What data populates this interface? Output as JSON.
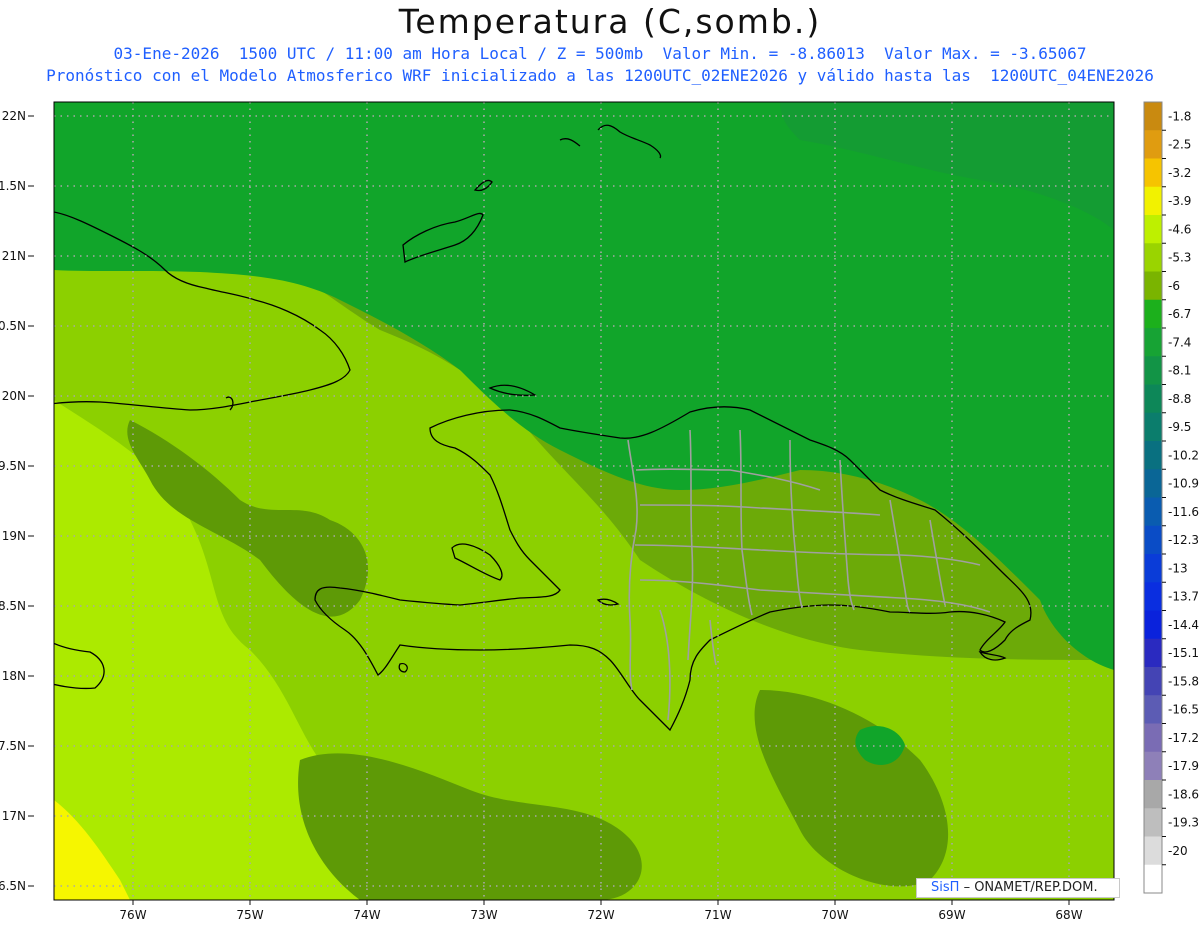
{
  "title": "Temperatura (C,somb.)",
  "subtitle_line1": "03-Ene-2026  1500 UTC / 11:00 am Hora Local / Z = 500mb  Valor Min. = -8.86013  Valor Max. = -3.65067",
  "subtitle_line2": "Pronóstico con el Modelo Atmosferico WRF inicializado a las 1200UTC_02ENE2026 y válido hasta las  1200UTC_04ENE2026",
  "credit": {
    "brand": "SisΠ",
    "text": "– ONAMET/REP.DOM."
  },
  "lat_labels": [
    "22N",
    "1.5N",
    "21N",
    "0.5N",
    "20N",
    "9.5N",
    "19N",
    "8.5N",
    "18N",
    "7.5N",
    "17N",
    "6.5N"
  ],
  "lon_labels": [
    "76W",
    "75W",
    "74W",
    "73W",
    "72W",
    "71W",
    "70W",
    "69W",
    "68W"
  ],
  "colorbar": {
    "labels": [
      "-1.8",
      "-2.5",
      "-3.2",
      "-3.9",
      "-4.6",
      "-5.3",
      "-6",
      "-6.7",
      "-7.4",
      "-8.1",
      "-8.8",
      "-9.5",
      "-10.2",
      "-10.9",
      "-11.6",
      "-12.3",
      "-13",
      "-13.7",
      "-14.4",
      "-15.1",
      "-15.8",
      "-16.5",
      "-17.2",
      "-17.9",
      "-18.6",
      "-19.3",
      "-20"
    ],
    "colors": [
      "#c98a10",
      "#e09c10",
      "#f6c400",
      "#f2f200",
      "#bef000",
      "#9ad400",
      "#7ab400",
      "#1cb01c",
      "#17a334",
      "#129446",
      "#0d8758",
      "#0b7d6c",
      "#097080",
      "#0a6696",
      "#0a5cb0",
      "#0a4cc6",
      "#0a3cd8",
      "#0a2ee0",
      "#0a22dc",
      "#2a2ac0",
      "#4444b4",
      "#5c5cb4",
      "#7a6cb4",
      "#8e80b8",
      "#a8a8a8",
      "#bebebe",
      "#dcdcdc",
      "#ffffff"
    ]
  },
  "colors": {
    "deep_green": "#11a52a",
    "green": "#6caa08",
    "dark_olive": "#5e9a06",
    "lime": "#8cd000",
    "yellow_green": "#acea00",
    "yellow": "#f6f600",
    "grid": "#a8a8a8"
  }
}
